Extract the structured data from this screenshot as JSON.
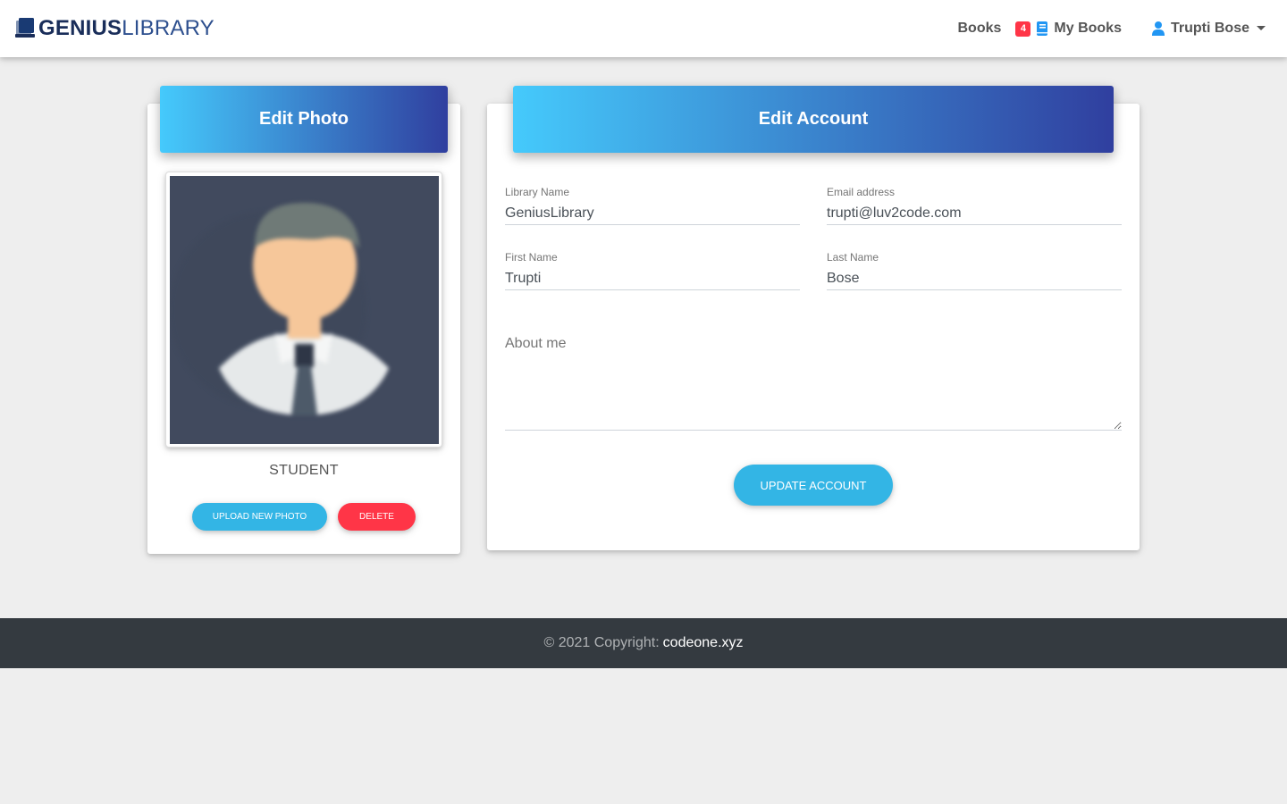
{
  "brand": {
    "part1": "GENIUS",
    "part2": "LIBRARY",
    "icon": "book-stack-icon"
  },
  "nav": {
    "books_label": "Books",
    "cart_count": "4",
    "my_books_label": "My Books",
    "user_name": "Trupti Bose"
  },
  "photo_card": {
    "title": "Edit Photo",
    "role": "STUDENT",
    "upload_label": "Upload New Photo",
    "delete_label": "Delete"
  },
  "account_card": {
    "title": "Edit Account",
    "library_name": {
      "label": "Library Name",
      "value": "GeniusLibrary"
    },
    "email": {
      "label": "Email address",
      "value": "trupti@luv2code.com"
    },
    "first_name": {
      "label": "First Name",
      "value": "Trupti"
    },
    "last_name": {
      "label": "Last Name",
      "value": "Bose"
    },
    "about": {
      "label": "About me",
      "value": ""
    },
    "update_label": "Update Account"
  },
  "footer": {
    "text": "© 2021 Copyright:",
    "link": "codeone.xyz"
  },
  "colors": {
    "header_gradient_start": "#45cafc",
    "header_gradient_end": "#303f9f",
    "primary_button": "#33b5e5",
    "danger_button": "#ff3547",
    "footer_bg": "#343a40"
  }
}
